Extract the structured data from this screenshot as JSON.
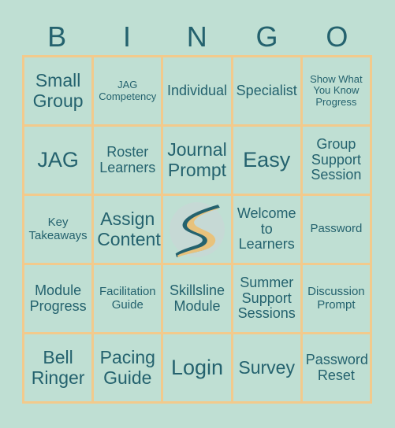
{
  "card": {
    "background_color": "#bfdfd3",
    "border_color": "#f2ca8c",
    "text_color": "#24626e"
  },
  "header": {
    "letters": [
      "B",
      "I",
      "N",
      "G",
      "O"
    ]
  },
  "logo": {
    "name": "skillsline-winding-road-logo",
    "circle_color": "#c6d9d5",
    "road_color": "#24626e",
    "stripe_color": "#e8c27c"
  },
  "grid": {
    "rows": [
      [
        {
          "text": "Small Group",
          "size": "lg"
        },
        {
          "text": "JAG Competency",
          "size": "xs"
        },
        {
          "text": "Individual",
          "size": "md"
        },
        {
          "text": "Specialist",
          "size": "md"
        },
        {
          "text": "Show What You Know Progress",
          "size": "xs"
        }
      ],
      [
        {
          "text": "JAG",
          "size": "xl"
        },
        {
          "text": "Roster Learners",
          "size": "md"
        },
        {
          "text": "Journal Prompt",
          "size": "lg"
        },
        {
          "text": "Easy",
          "size": "xl"
        },
        {
          "text": "Group Support Session",
          "size": "md"
        }
      ],
      [
        {
          "text": "Key Takeaways",
          "size": "sm"
        },
        {
          "text": "Assign Content",
          "size": "lg"
        },
        {
          "text": "",
          "size": "md",
          "free": true
        },
        {
          "text": "Welcome to Learners",
          "size": "md"
        },
        {
          "text": "Password",
          "size": "sm"
        }
      ],
      [
        {
          "text": "Module Progress",
          "size": "md"
        },
        {
          "text": "Facilitation Guide",
          "size": "sm"
        },
        {
          "text": "Skillsline Module",
          "size": "md"
        },
        {
          "text": "Summer Support Sessions",
          "size": "md"
        },
        {
          "text": "Discussion Prompt",
          "size": "sm"
        }
      ],
      [
        {
          "text": "Bell Ringer",
          "size": "lg"
        },
        {
          "text": "Pacing Guide",
          "size": "lg"
        },
        {
          "text": "Login",
          "size": "xl"
        },
        {
          "text": "Survey",
          "size": "lg"
        },
        {
          "text": "Password Reset",
          "size": "md"
        }
      ]
    ]
  }
}
